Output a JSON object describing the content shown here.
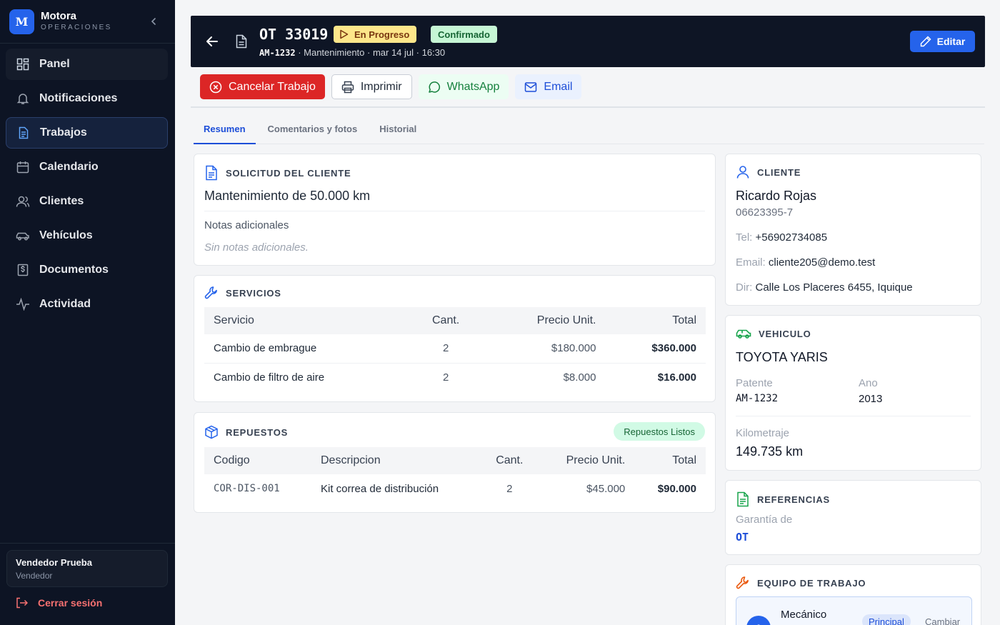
{
  "brand": {
    "logo": "M",
    "name": "Motora",
    "subtitle": "OPERACIONES"
  },
  "nav": [
    {
      "label": "Panel",
      "icon": "dashboard-icon"
    },
    {
      "label": "Notificaciones",
      "icon": "bell-icon"
    },
    {
      "label": "Trabajos",
      "icon": "document-icon"
    },
    {
      "label": "Calendario",
      "icon": "calendar-icon"
    },
    {
      "label": "Clientes",
      "icon": "users-icon"
    },
    {
      "label": "Vehículos",
      "icon": "car-icon"
    },
    {
      "label": "Documentos",
      "icon": "dollar-document-icon"
    },
    {
      "label": "Actividad",
      "icon": "activity-icon"
    }
  ],
  "user": {
    "name": "Vendedor Prueba",
    "role": "Vendedor"
  },
  "logout_label": "Cerrar sesión",
  "header": {
    "title": "OT 33019",
    "status": "En Progreso",
    "confirm": "Confirmado",
    "plate": "AM-1232",
    "subtitle_rest": " · Mantenimiento · mar 14 jul · 16:30",
    "edit_label": "Editar"
  },
  "actions": {
    "cancel": "Cancelar Trabajo",
    "print": "Imprimir",
    "whatsapp": "WhatsApp",
    "email": "Email"
  },
  "tabs": [
    "Resumen",
    "Comentarios y fotos",
    "Historial"
  ],
  "solicitud": {
    "title": "SOLICITUD DEL CLIENTE",
    "request": "Mantenimiento de 50.000 km",
    "notes_label": "Notas adicionales",
    "notes_value": "Sin notas adicionales."
  },
  "servicios": {
    "title": "SERVICIOS",
    "headers": [
      "Servicio",
      "Cant.",
      "Precio Unit.",
      "Total"
    ],
    "rows": [
      [
        "Cambio de embrague",
        "2",
        "$180.000",
        "$360.000"
      ],
      [
        "Cambio de filtro de aire",
        "2",
        "$8.000",
        "$16.000"
      ]
    ]
  },
  "repuestos": {
    "title": "REPUESTOS",
    "badge": "Repuestos Listos",
    "headers": [
      "Codigo",
      "Descripcion",
      "Cant.",
      "Precio Unit.",
      "Total"
    ],
    "rows": [
      [
        "COR-DIS-001",
        "Kit correa de distribución",
        "2",
        "$45.000",
        "$90.000"
      ]
    ]
  },
  "cliente": {
    "title": "CLIENTE",
    "name": "Ricardo Rojas",
    "rut": "06623395-7",
    "tel_label": "Tel:",
    "tel": "+56902734085",
    "email_label": "Email:",
    "email": "cliente205@demo.test",
    "dir_label": "Dir:",
    "dir": "Calle Los Placeres 6455, Iquique"
  },
  "vehiculo": {
    "title": "VEHICULO",
    "name": "TOYOTA YARIS",
    "patente_label": "Patente",
    "patente": "AM-1232",
    "ano_label": "Ano",
    "ano": "2013",
    "km_label": "Kilometraje",
    "km": "149.735 km"
  },
  "referencias": {
    "title": "REFERENCIAS",
    "label": "Garantía de",
    "link": "OT"
  },
  "equipo": {
    "title": "EQUIPO DE TRABAJO",
    "avatar": "A",
    "role": "Mecánico",
    "badge": "Principal",
    "action": "Cambiar"
  },
  "colors": {
    "sidebar_bg": "#0d1424",
    "accent": "#2563eb",
    "danger": "#dc2626",
    "status_progress": "#fde68a",
    "status_confirmed": "#c6f6d5"
  }
}
